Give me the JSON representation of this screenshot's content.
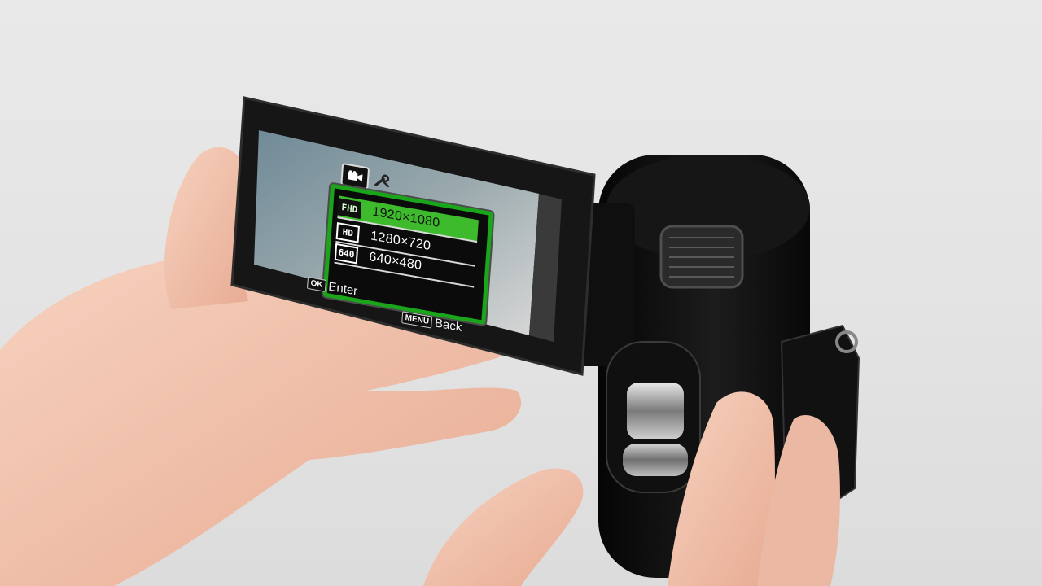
{
  "photo": {
    "subject": "camcorder-lcd",
    "colors": {
      "background": "#e5e5e5",
      "camcorder_body": "#111111",
      "skin": "#f0c2ad",
      "lcd_frame": "#1b1b1b",
      "menu_highlight": "#3dbb2d",
      "menu_border": "#1aa51a"
    }
  },
  "lcd_menu": {
    "tabs": [
      {
        "icon": "video-camera-icon",
        "selected": true
      },
      {
        "icon": "wrench-icon",
        "selected": false
      }
    ],
    "options": [
      {
        "badge": "FHD",
        "value": "1920×1080",
        "selected": true
      },
      {
        "badge": "HD",
        "value": "1280×720",
        "selected": false
      },
      {
        "badge": "640",
        "value": "640×480",
        "selected": false
      }
    ],
    "hints": {
      "enter_key": "OK",
      "enter_label": "Enter",
      "back_key": "MENU",
      "back_label": "Back"
    }
  }
}
